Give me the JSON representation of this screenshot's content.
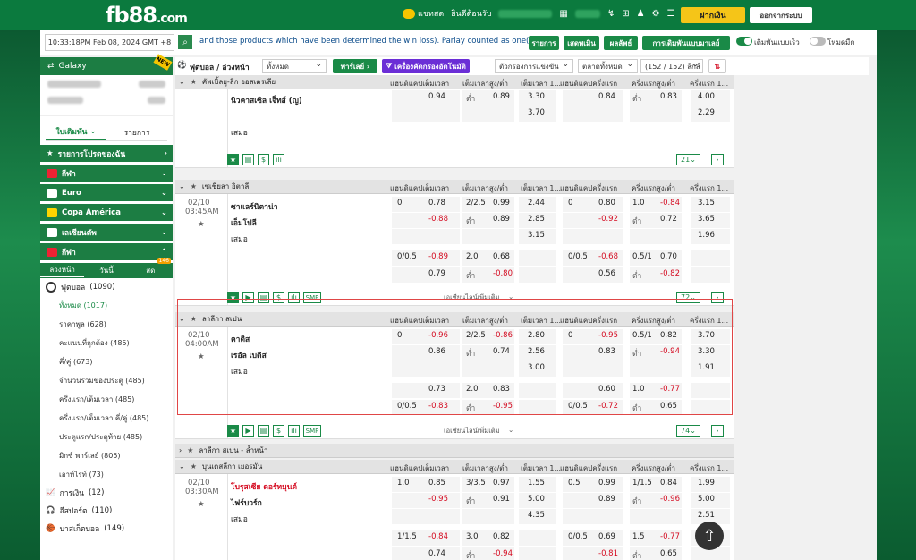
{
  "header": {
    "logo_main": "fb88",
    "logo_tld": ".com",
    "chat_label": "แชทสด",
    "welcome": "ยินดีต้อนรับ",
    "balance_hidden": "",
    "deposit": "ฝากเงิน",
    "logout": "ออกจากระบบ"
  },
  "ticker": {
    "datetime": "10:33:18PM Feb 08, 2024 GMT +8",
    "message": "and those products which have been determined the win loss). Parlay counted as one(1).",
    "buttons": [
      "รายการ",
      "เสดพเมิน",
      "ผลลัพธ์",
      "การเดิมพันแบบมาเลย์"
    ],
    "quick_bet": "เดิมพันแบบเร็ว",
    "dark_mode": "โหมดมืด"
  },
  "sidebar": {
    "galaxy": "Galaxy",
    "galaxy_badge": "NEW",
    "tabs": [
      "ใบเดิมพัน",
      "รายการ"
    ],
    "menus": [
      "รายการโปรดของฉัน",
      "กีฬา",
      "Euro",
      "Copa América",
      "เลเซียนคัพ",
      "กีฬา"
    ],
    "subtabs": [
      "ล่วงหน้า",
      "วันนี้",
      "สด"
    ],
    "subtab_badge": "146",
    "sport": "ฟุตบอล",
    "sport_count": "(1090)",
    "subitems": [
      "ทั้งหมด (1017)",
      "ราคาพูล (628)",
      "คะแนนที่ถูกต้อง (485)",
      "คี่/คู่ (673)",
      "จำนวนรวมของประตู (485)",
      "ครึ่งแรก/เต็มเวลา (485)",
      "ครึ่งแรก/เต็มเวลา คี่/คู่ (485)",
      "ประตูแรก/ประตูท้าย (485)",
      "มิกซ์ พาร์เลย์ (805)",
      "เอาท์ไรท์ (73)"
    ],
    "others": [
      {
        "name": "การเงิน",
        "count": "(12)"
      },
      {
        "name": "อีสปอร์ต",
        "count": "(110)"
      },
      {
        "name": "บาสเก็ตบอล",
        "count": "(149)"
      }
    ]
  },
  "filter": {
    "title": "ฟุตบอล / ล่วงหน้า",
    "select_all": "ทั้งหมด",
    "parlay": "พาร์เลย์",
    "toolbox": "เครื่องคัดกรองอัตโนมัติ",
    "sort": "ตัวกรองการแข่งขัน",
    "market": "ตลาดทั้งหมด",
    "league_count": "(152 / 152) ลีกส์"
  },
  "columns": [
    "แฮนดิแคปเต็มเวลา",
    "เต็มเวลาสูง/ต่ำ",
    "เต็มเวลา 1...",
    "แฮนดิแคปครึ่งแรก",
    "ครึ่งแรกสูง/ต่ำ",
    "ครึ่งแรก 1..."
  ],
  "leagues": [
    {
      "name": "คัพเบิ้ลยู-ลีก ออสเตรเลีย",
      "date": "",
      "time": "",
      "home": "นิวคาสเซิล เจ็ทส์ (ญ)",
      "away": "",
      "draw": "เสมอ",
      "rows": [
        [
          "",
          "0.94",
          "ต่ำ",
          "0.89",
          "3.30",
          "",
          "0.84",
          "ต่ำ",
          "0.83",
          "4.00"
        ],
        [
          "",
          "",
          "",
          "",
          "3.70",
          "",
          "",
          "",
          "",
          "2.29"
        ]
      ],
      "pager": "21"
    },
    {
      "name": "เซเชียลา อิตาลี",
      "date": "02/10",
      "time": "03:45AM",
      "home": "ซาแลร์นิตาน่า",
      "away": "เอ็มโปลี",
      "draw": "เสมอ",
      "rows": [
        [
          "0",
          "0.78",
          "2/2.5",
          "0.99",
          "2.44",
          "0",
          "0.80",
          "1.0",
          "-0.84",
          "3.15"
        ],
        [
          "",
          "-0.88",
          "ต่ำ",
          "0.89",
          "2.85",
          "",
          "-0.92",
          "ต่ำ",
          "0.72",
          "3.65"
        ],
        [
          "",
          "",
          "",
          "",
          "3.15",
          "",
          "",
          "",
          "",
          "1.96"
        ],
        [
          "0/0.5",
          "-0.89",
          "2.0",
          "0.68",
          "",
          "0/0.5",
          "-0.68",
          "0.5/1",
          "0.70",
          ""
        ],
        [
          "",
          "0.79",
          "ต่ำ",
          "-0.80",
          "",
          "",
          "0.56",
          "ต่ำ",
          "-0.82",
          ""
        ]
      ],
      "more": "เอเชียนไลน์เพิ่มเติม",
      "pager": "72"
    },
    {
      "name": "ลาลีกา สเปน",
      "date": "02/10",
      "time": "04:00AM",
      "home": "คาดิส",
      "away": "เรอัล เบติส",
      "draw": "เสมอ",
      "rows": [
        [
          "0",
          "-0.96",
          "2/2.5",
          "-0.86",
          "2.80",
          "0",
          "-0.95",
          "0.5/1",
          "0.82",
          "3.70"
        ],
        [
          "",
          "0.86",
          "ต่ำ",
          "0.74",
          "2.56",
          "",
          "0.83",
          "ต่ำ",
          "-0.94",
          "3.30"
        ],
        [
          "",
          "",
          "",
          "",
          "3.00",
          "",
          "",
          "",
          "",
          "1.91"
        ],
        [
          "",
          "0.73",
          "2.0",
          "0.83",
          "",
          "",
          "0.60",
          "1.0",
          "-0.77",
          ""
        ],
        [
          "0/0.5",
          "-0.83",
          "ต่ำ",
          "-0.95",
          "",
          "0/0.5",
          "-0.72",
          "ต่ำ",
          "0.65",
          ""
        ]
      ],
      "more": "เอเชียนไลน์เพิ่มเติม",
      "pager": "74"
    },
    {
      "name": "ลาลีกา สเปน - ล้ำหน้า"
    },
    {
      "name": "บุนเดสลีกา เยอรมัน",
      "date": "02/10",
      "time": "03:30AM",
      "home": "โบรุสเซีย ดอร์ทมุนด์",
      "away": "ไฟร์บวร์ก",
      "draw": "เสมอ",
      "rows": [
        [
          "1.0",
          "0.85",
          "3/3.5",
          "0.97",
          "1.55",
          "0.5",
          "0.99",
          "1/1.5",
          "0.84",
          "1.99"
        ],
        [
          "",
          "-0.95",
          "ต่ำ",
          "0.91",
          "5.00",
          "",
          "0.89",
          "ต่ำ",
          "-0.96",
          "5.00"
        ],
        [
          "",
          "",
          "",
          "",
          "4.35",
          "",
          "",
          "",
          "",
          "2.51"
        ],
        [
          "1/1.5",
          "-0.84",
          "3.0",
          "0.82",
          "",
          "0/0.5",
          "0.69",
          "1.5",
          "-0.77",
          ""
        ],
        [
          "",
          "0.74",
          "ต่ำ",
          "-0.94",
          "",
          "",
          "-0.81",
          "ต่ำ",
          "0.65",
          ""
        ]
      ],
      "more": "เอเชียนไลน์เพิ่มเติม",
      "pager": "79"
    }
  ],
  "tools": {
    "smp": "SMP"
  }
}
